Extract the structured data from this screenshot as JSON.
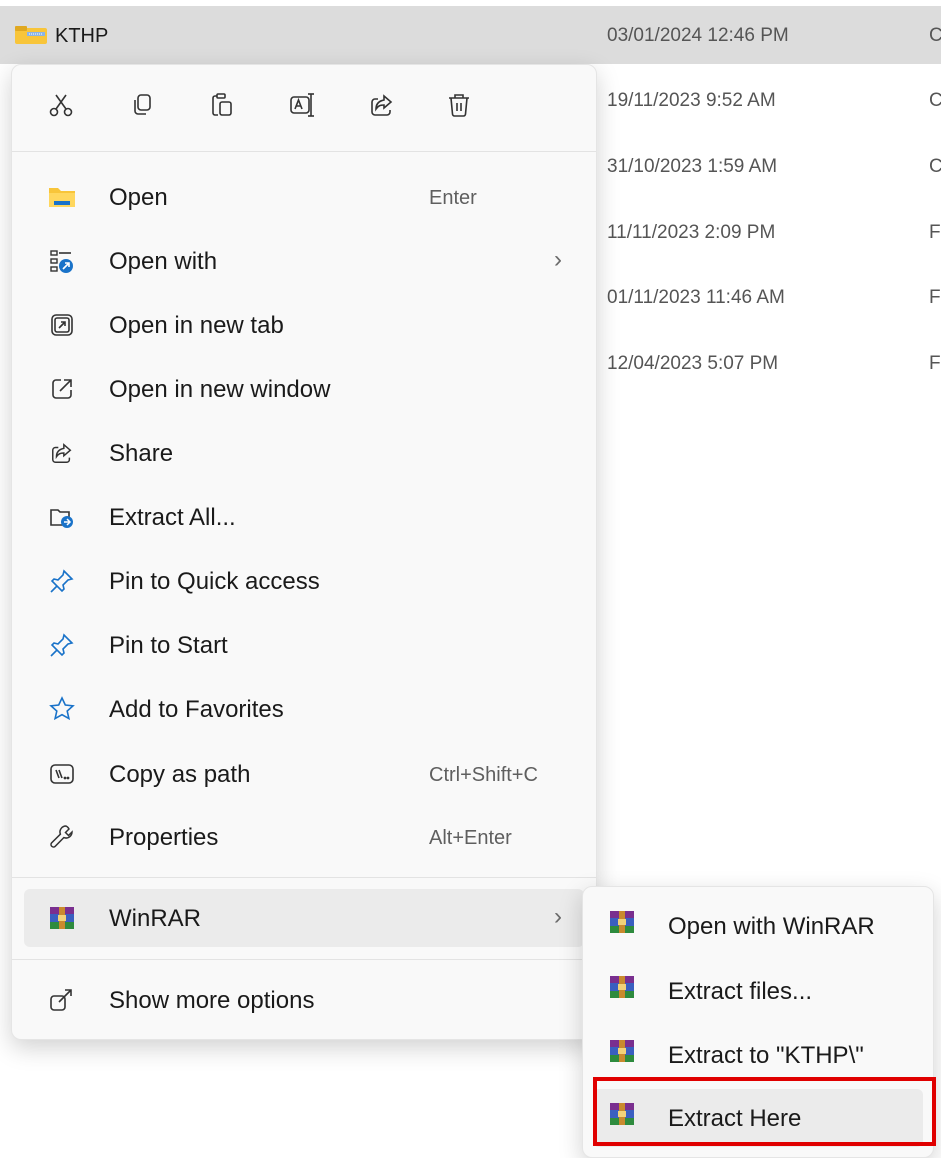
{
  "explorer": {
    "selected_file": {
      "name": "KTHP",
      "icon": "zip-folder-icon"
    },
    "dates": [
      "03/01/2024 12:46 PM",
      "19/11/2023 9:52 AM",
      "31/10/2023 1:59 AM",
      "11/11/2023 2:09 PM",
      "01/11/2023 11:46 AM",
      "12/04/2023 5:07 PM"
    ],
    "type_initials": [
      "C",
      "C",
      "C",
      "F",
      "F",
      "F"
    ]
  },
  "context_menu": {
    "toolbar": [
      {
        "name": "cut",
        "icon": "scissors-icon"
      },
      {
        "name": "copy",
        "icon": "copy-icon"
      },
      {
        "name": "paste",
        "icon": "paste-icon"
      },
      {
        "name": "rename",
        "icon": "rename-icon"
      },
      {
        "name": "share",
        "icon": "share-icon"
      },
      {
        "name": "delete",
        "icon": "trash-icon"
      }
    ],
    "items": [
      {
        "label": "Open",
        "accel": "Enter",
        "icon": "folder-icon"
      },
      {
        "label": "Open with",
        "chevron": "›",
        "icon": "open-with-icon"
      },
      {
        "label": "Open in new tab",
        "icon": "new-tab-icon"
      },
      {
        "label": "Open in new window",
        "icon": "new-window-icon"
      },
      {
        "label": "Share",
        "icon": "share-icon"
      },
      {
        "label": "Extract All...",
        "icon": "extract-icon"
      },
      {
        "label": "Pin to Quick access",
        "icon": "pin-icon"
      },
      {
        "label": "Pin to Start",
        "icon": "pin-icon"
      },
      {
        "label": "Add to Favorites",
        "icon": "star-icon"
      },
      {
        "label": "Copy as path",
        "accel": "Ctrl+Shift+C",
        "icon": "path-icon"
      },
      {
        "label": "Properties",
        "accel": "Alt+Enter",
        "icon": "wrench-icon"
      },
      {
        "label": "WinRAR",
        "chevron": "›",
        "icon": "winrar-icon"
      },
      {
        "label": "Show more options",
        "icon": "more-options-icon"
      }
    ]
  },
  "winrar_submenu": {
    "items": [
      {
        "label": "Open with WinRAR",
        "icon": "winrar-icon"
      },
      {
        "label": "Extract files...",
        "icon": "winrar-icon"
      },
      {
        "label": "Extract to \"KTHP\\\"",
        "icon": "winrar-icon"
      },
      {
        "label": "Extract Here",
        "icon": "winrar-icon"
      }
    ]
  },
  "colors": {
    "selection": "#dcdcdc",
    "menu_bg": "#f9f9f9",
    "hover": "#ebebeb",
    "highlight_box": "#e00000",
    "accent_blue": "#1a73c9",
    "folder_yellow": "#f8c53a"
  }
}
